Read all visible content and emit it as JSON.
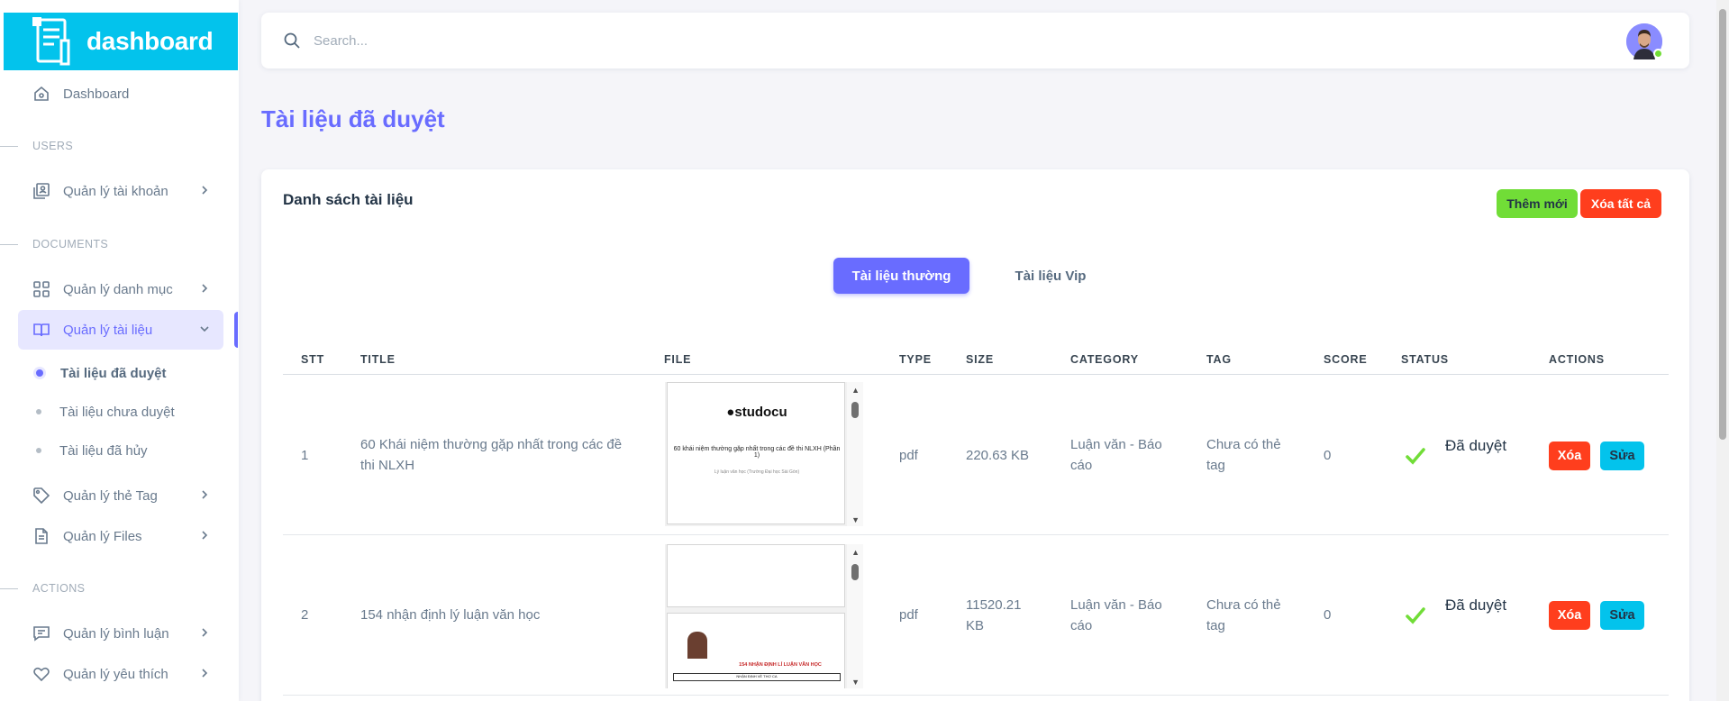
{
  "brand": {
    "name": "dashboard"
  },
  "sidebar": {
    "dashboard": "Dashboard",
    "headers": {
      "users": "USERS",
      "documents": "DOCUMENTS",
      "actions": "ACTIONS"
    },
    "items": {
      "accounts": "Quản lý tài khoản",
      "categories": "Quản lý danh mục",
      "documents": "Quản lý tài liệu",
      "tags": "Quản lý thẻ Tag",
      "files": "Quản lý Files",
      "comments": "Quản lý bình luận",
      "favorites": "Quản lý yêu thích"
    },
    "sub_items": {
      "approved": "Tài liệu đã duyệt",
      "pending": "Tài liệu chưa duyệt",
      "cancelled": "Tài liệu đã hủy"
    }
  },
  "search": {
    "placeholder": "Search..."
  },
  "page": {
    "title": "Tài liệu đã duyệt"
  },
  "card": {
    "title": "Danh sách tài liệu",
    "add_label": "Thêm mới",
    "clear_label": "Xóa tất cả",
    "tabs": {
      "normal": "Tài liệu thường",
      "vip": "Tài liệu Vip"
    }
  },
  "table": {
    "headers": {
      "stt": "STT",
      "title": "TITLE",
      "file": "FILE",
      "type": "TYPE",
      "size": "SIZE",
      "category": "CATEGORY",
      "tag": "TAG",
      "score": "SCORE",
      "status": "STATUS",
      "actions": "ACTIONS"
    },
    "rows": [
      {
        "stt": "1",
        "title": "60 Khái niệm thường gặp nhất trong các đề thi NLXH",
        "type": "pdf",
        "size": "220.63 KB",
        "category": "Luận văn - Báo cáo",
        "tag": "Chưa có thẻ tag",
        "score": "0",
        "status": "Đã duyệt",
        "delete_label": "Xóa",
        "edit_label": "Sửa",
        "preview": {
          "logo": "studocu",
          "heading": "60 khái niệm thường gặp nhất trong các đề thi NLXH (Phần 1)",
          "subtitle": "Lý luận văn học (Trường Đại học Sài Gòn)"
        }
      },
      {
        "stt": "2",
        "title": "154 nhận định lý luận văn học",
        "type": "pdf",
        "size": "11520.21 KB",
        "category": "Luận văn - Báo cáo",
        "tag": "Chưa có thẻ tag",
        "score": "0",
        "status": "Đã duyệt",
        "delete_label": "Xóa",
        "edit_label": "Sửa",
        "preview": {
          "heading": "154 NHẬN ĐỊNH LÍ LUẬN VĂN HỌC",
          "section": "NHẬN ĐỊNH VỀ THƠ CA"
        }
      }
    ]
  },
  "colors": {
    "primary": "#696cff",
    "brand": "#03c3ec",
    "success": "#71dd37",
    "danger": "#ff3e1d"
  }
}
